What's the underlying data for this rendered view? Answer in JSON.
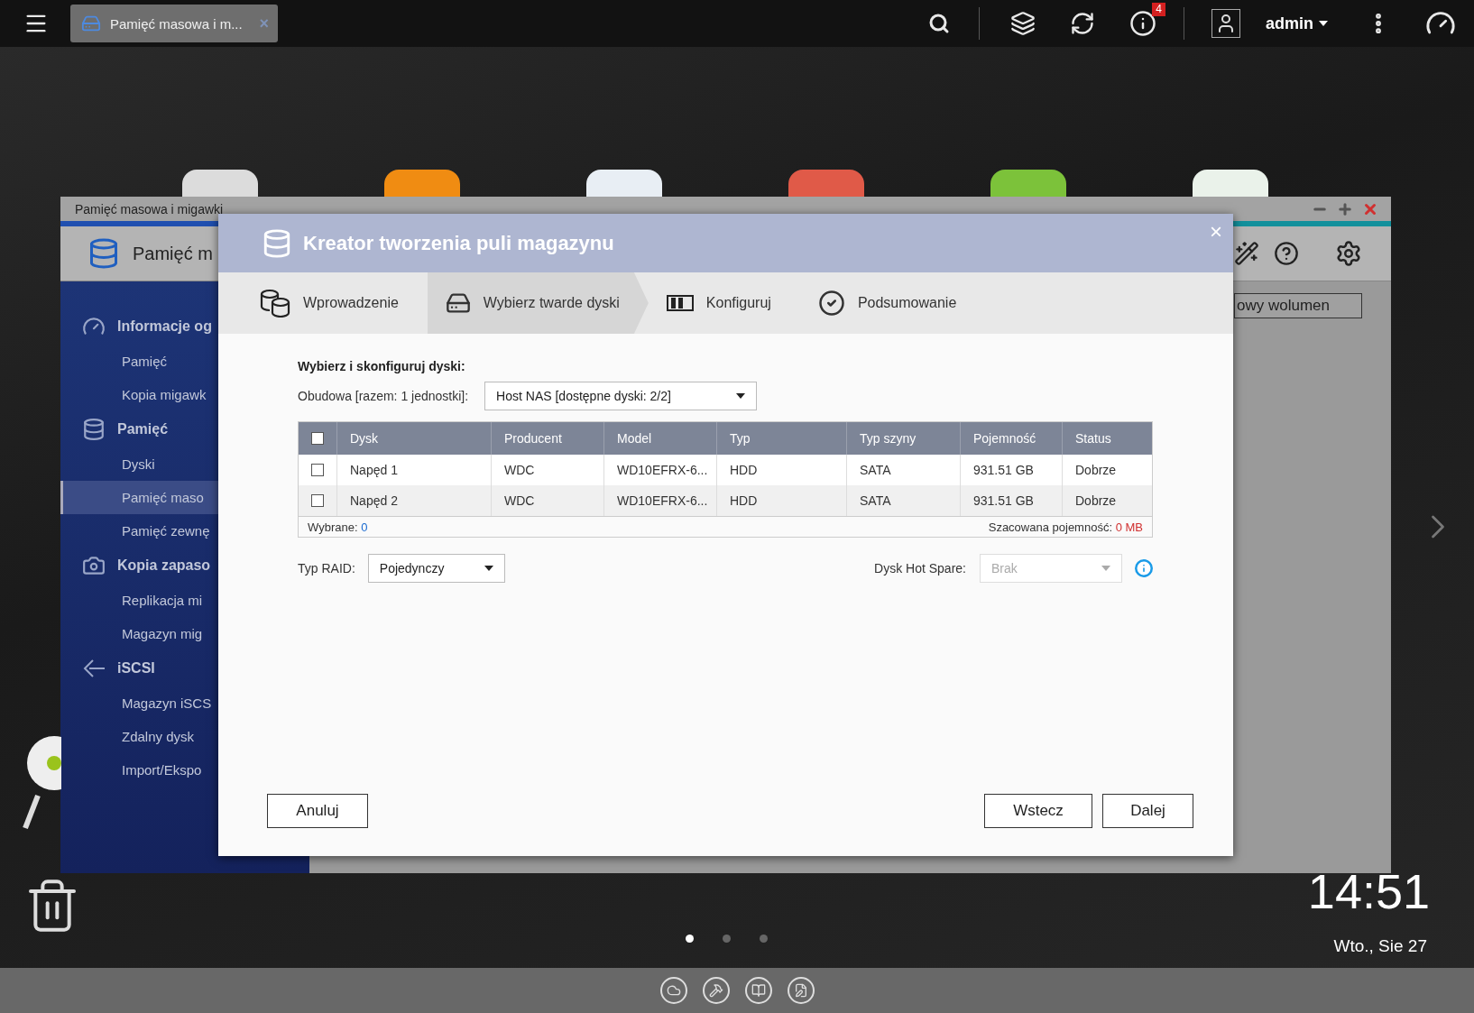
{
  "top_bar": {
    "tab": {
      "title": "Pamięć masowa i m...",
      "close": "×"
    },
    "notification_count": "4",
    "user": "admin"
  },
  "app_window": {
    "title": "Pamięć masowa i migawki",
    "header_title": "Pamięć m",
    "toolbar_button": "owy wolumen",
    "sidebar": [
      {
        "label": "Informacje og",
        "children": [
          {
            "label": "Pamięć",
            "selected": false
          },
          {
            "label": "Kopia migawk",
            "selected": false
          }
        ]
      },
      {
        "label": "Pamięć",
        "children": [
          {
            "label": "Dyski",
            "selected": false
          },
          {
            "label": "Pamięć maso",
            "selected": true
          },
          {
            "label": "Pamięć zewnę",
            "selected": false
          }
        ]
      },
      {
        "label": "Kopia zapaso",
        "children": [
          {
            "label": "Replikacja mi",
            "selected": false
          },
          {
            "label": "Magazyn mig",
            "selected": false
          }
        ]
      },
      {
        "label": "iSCSI",
        "children": [
          {
            "label": "Magazyn iSCS",
            "selected": false
          },
          {
            "label": "Zdalny dysk",
            "selected": false
          },
          {
            "label": "Import/Ekspo",
            "selected": false
          }
        ]
      }
    ]
  },
  "dialog": {
    "title": "Kreator tworzenia puli magazynu",
    "close": "×",
    "steps": [
      {
        "label": "Wprowadzenie",
        "selected": false
      },
      {
        "label": "Wybierz twarde dyski",
        "selected": true
      },
      {
        "label": "Konfiguruj",
        "selected": false
      },
      {
        "label": "Podsumowanie",
        "selected": false
      }
    ],
    "section_title": "Wybierz i skonfiguruj dyski:",
    "enclosure": {
      "label": "Obudowa [razem: 1 jednostki]:",
      "value": "Host NAS [dostępne dyski: 2/2]"
    },
    "table": {
      "select_all_checked": false,
      "columns": [
        "Dysk",
        "Producent",
        "Model",
        "Typ",
        "Typ szyny",
        "Pojemność",
        "Status"
      ],
      "rows": [
        {
          "checked": false,
          "cells": [
            "Napęd 1",
            "WDC",
            "WD10EFRX-6...",
            "HDD",
            "SATA",
            "931.51 GB",
            "Dobrze"
          ]
        },
        {
          "checked": false,
          "cells": [
            "Napęd 2",
            "WDC",
            "WD10EFRX-6...",
            "HDD",
            "SATA",
            "931.51 GB",
            "Dobrze"
          ]
        }
      ]
    },
    "footer": {
      "selected_label": "Wybrane:",
      "selected_value": "0",
      "capacity_label": "Szacowana pojemność:",
      "capacity_value": "0 MB"
    },
    "raid": {
      "label": "Typ RAID:",
      "value": "Pojedynczy"
    },
    "hot_spare": {
      "label": "Dysk Hot Spare:",
      "value": "Brak",
      "disabled": true
    },
    "buttons": {
      "cancel": "Anuluj",
      "back": "Wstecz",
      "next": "Dalej"
    }
  },
  "clock": {
    "time": "14:51",
    "date": "Wto., Sie 27"
  },
  "pages": [
    {
      "selected": true
    },
    {
      "selected": false
    },
    {
      "selected": false
    }
  ]
}
